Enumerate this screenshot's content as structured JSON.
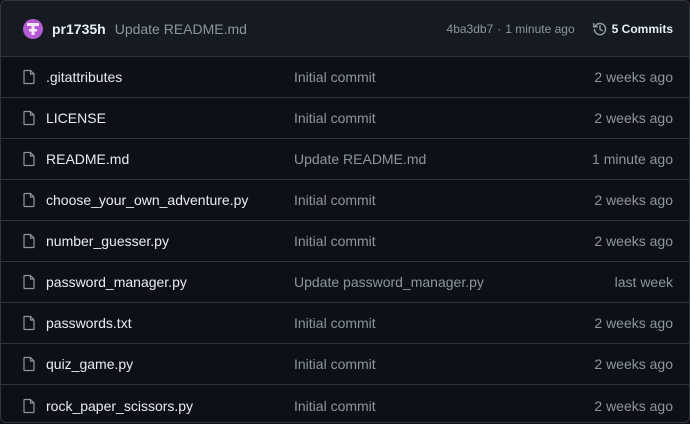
{
  "latest_commit": {
    "author": "pr1735h",
    "message": "Update README.md",
    "sha": "4ba3db7",
    "separator": "·",
    "time": "1 minute ago",
    "commits_label": "5 Commits"
  },
  "files": [
    {
      "name": ".gitattributes",
      "commit": "Initial commit",
      "time": "2 weeks ago"
    },
    {
      "name": "LICENSE",
      "commit": "Initial commit",
      "time": "2 weeks ago"
    },
    {
      "name": "README.md",
      "commit": "Update README.md",
      "time": "1 minute ago"
    },
    {
      "name": "choose_your_own_adventure.py",
      "commit": "Initial commit",
      "time": "2 weeks ago"
    },
    {
      "name": "number_guesser.py",
      "commit": "Initial commit",
      "time": "2 weeks ago"
    },
    {
      "name": "password_manager.py",
      "commit": "Update password_manager.py",
      "time": "last week"
    },
    {
      "name": "passwords.txt",
      "commit": "Initial commit",
      "time": "2 weeks ago"
    },
    {
      "name": "quiz_game.py",
      "commit": "Initial commit",
      "time": "2 weeks ago"
    },
    {
      "name": "rock_paper_scissors.py",
      "commit": "Initial commit",
      "time": "2 weeks ago"
    }
  ],
  "icons": {
    "avatar": "avatar-icon",
    "history": "history-icon",
    "file": "file-icon"
  },
  "colors": {
    "background": "#0d1117",
    "header_background": "#161b22",
    "border": "#30363d",
    "text_primary": "#e6edf3",
    "text_muted": "#8d96a0",
    "avatar": "#b55bd6"
  }
}
